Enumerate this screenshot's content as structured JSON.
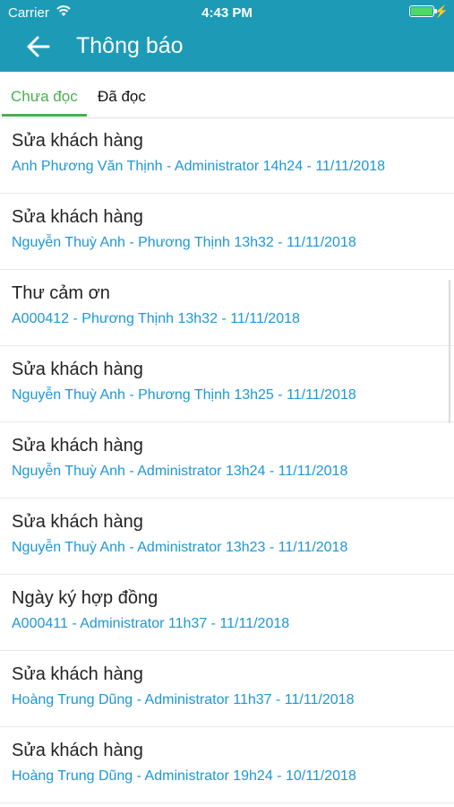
{
  "status_bar": {
    "carrier": "Carrier",
    "time": "4:43 PM",
    "battery_level": 1.0
  },
  "header": {
    "title": "Thông báo",
    "back_icon": "arrow-left-icon"
  },
  "tabs": [
    {
      "label": "Chưa đọc",
      "active": true
    },
    {
      "label": "Đã đọc",
      "active": false
    }
  ],
  "notifications": [
    {
      "title": "Sửa khách hàng",
      "subtitle": "Anh Phương Văn Thịnh - Administrator 14h24 - 11/11/2018"
    },
    {
      "title": "Sửa khách hàng",
      "subtitle": "Nguyễn Thuỳ Anh - Phương Thịnh 13h32 - 11/11/2018"
    },
    {
      "title": "Thư cảm ơn",
      "subtitle": "A000412 - Phương Thịnh 13h32 - 11/11/2018"
    },
    {
      "title": "Sửa khách hàng",
      "subtitle": "Nguyễn Thuỳ Anh - Phương Thịnh 13h25 - 11/11/2018"
    },
    {
      "title": "Sửa khách hàng",
      "subtitle": "Nguyễn Thuỳ Anh - Administrator 13h24 - 11/11/2018"
    },
    {
      "title": "Sửa khách hàng",
      "subtitle": "Nguyễn Thuỳ Anh - Administrator 13h23 - 11/11/2018"
    },
    {
      "title": "Ngày ký hợp đồng",
      "subtitle": "A000411 - Administrator 11h37 - 11/11/2018"
    },
    {
      "title": "Sửa khách hàng",
      "subtitle": "Hoàng Trung Dũng - Administrator 11h37 - 11/11/2018"
    },
    {
      "title": "Sửa khách hàng",
      "subtitle": "Hoàng Trung Dũng - Administrator 19h24 - 10/11/2018"
    }
  ],
  "colors": {
    "header": "#1d9bb6",
    "active_tab": "#4cae4f",
    "subtitle": "#1e97d5",
    "battery": "#4cd964"
  }
}
